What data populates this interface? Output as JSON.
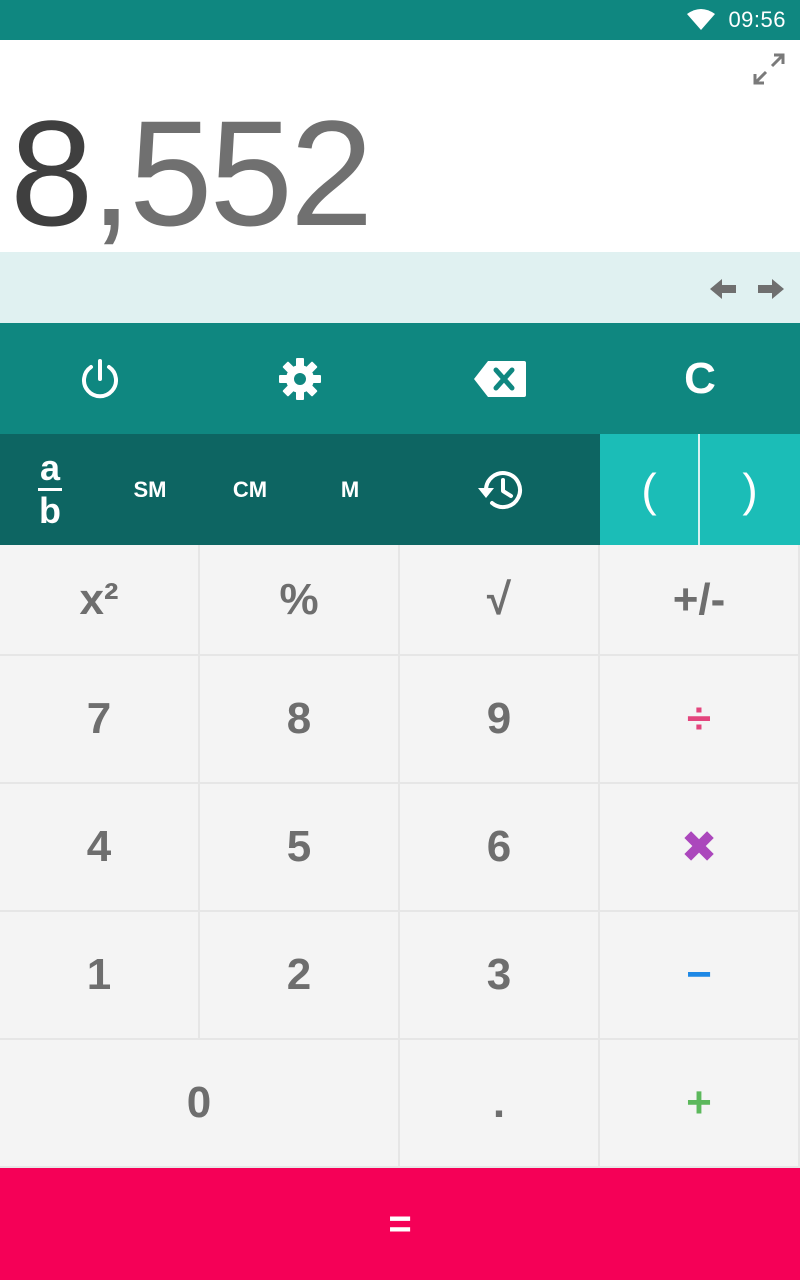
{
  "status_bar": {
    "time": "09:56"
  },
  "display": {
    "value_first": "8",
    "value_rest": ",552"
  },
  "function_row": {
    "clear_label": "C"
  },
  "memory_row": {
    "fraction_top": "a",
    "fraction_bottom": "b",
    "sm_label": "SM",
    "cm_label": "CM",
    "m_label": "M",
    "open_paren": "(",
    "close_paren": ")"
  },
  "keypad": {
    "square": "x²",
    "percent": "%",
    "sqrt": "√",
    "negate": "+/-",
    "seven": "7",
    "eight": "8",
    "nine": "9",
    "divide": "÷",
    "four": "4",
    "five": "5",
    "six": "6",
    "multiply": "✖",
    "one": "1",
    "two": "2",
    "three": "3",
    "subtract": "−",
    "zero": "0",
    "decimal": ".",
    "add": "+"
  },
  "equals_label": "=",
  "colors": {
    "primary": "#0f8780",
    "primary_dark": "#0d6562",
    "accent_teal": "#1bbdb7",
    "equals": "#f50057",
    "divide": "#e3457d",
    "multiply": "#ab47bc",
    "subtract": "#1e88e5",
    "add": "#5cb85c"
  },
  "icons": {
    "status": [
      "wifi-icon"
    ],
    "display": [
      "expand-icon",
      "arrow-left-icon",
      "arrow-right-icon"
    ],
    "function_row": [
      "power-icon",
      "settings-icon",
      "backspace-icon"
    ],
    "memory_row": [
      "fraction-icon",
      "history-icon"
    ]
  }
}
